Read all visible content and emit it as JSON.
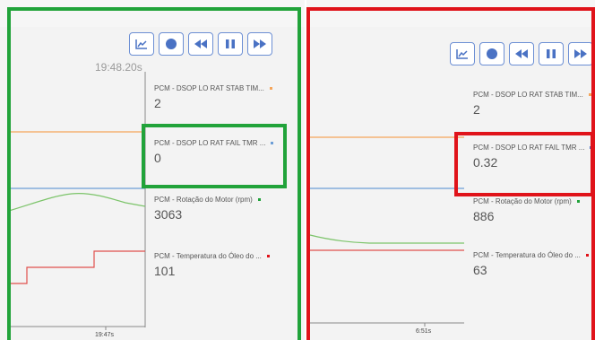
{
  "colors": {
    "accent_green": "#21a33a",
    "accent_red": "#e0131a",
    "button_border": "#6c8fd4",
    "series_orange": "#f5a55a",
    "series_blue": "#6d9ed6",
    "series_green": "#7cc46a",
    "series_red": "#e0504d"
  },
  "toolbar_icons": [
    "chart-icon",
    "record-icon",
    "rewind-icon",
    "pause-icon",
    "fast-forward-icon"
  ],
  "left_panel": {
    "timestamp": "19:48.20s",
    "xtick": "19:47s",
    "legend": [
      {
        "label": "PCM - DSOP LO RAT STAB TIM...",
        "value": "2",
        "color": "#f5a55a"
      },
      {
        "label": "PCM - DSOP LO RAT FAIL TMR ...",
        "value": "0",
        "color": "#6d9ed6"
      },
      {
        "label": "PCM - Rotação do Motor (rpm)",
        "value": "3063",
        "color": "#21a33a"
      },
      {
        "label": "PCM - Temperatura do Óleo do ...",
        "value": "101",
        "color": "#e0131a"
      }
    ]
  },
  "right_panel": {
    "xtick": "6:51s",
    "legend": [
      {
        "label": "PCM - DSOP LO RAT STAB TIM...",
        "value": "2",
        "color": "#f5a55a"
      },
      {
        "label": "PCM - DSOP LO RAT FAIL TMR ...",
        "value": "0.32",
        "color": "#6d9ed6"
      },
      {
        "label": "PCM - Rotação do Motor (rpm)",
        "value": "886",
        "color": "#21a33a"
      },
      {
        "label": "PCM - Temperatura do Óleo do ...",
        "value": "63",
        "color": "#e0131a"
      }
    ]
  }
}
